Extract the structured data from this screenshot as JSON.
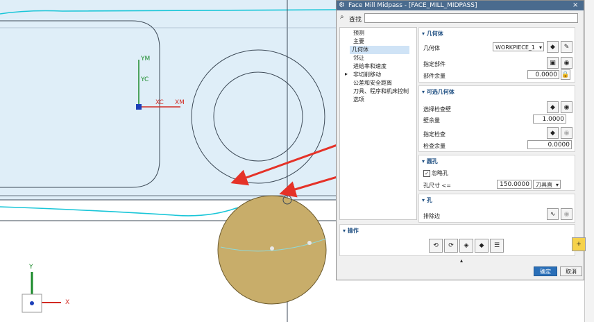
{
  "viewport": {
    "axis_labels": {
      "ym": "YM",
      "yc": "YC",
      "xc": "XC",
      "xm": "XM"
    },
    "triad_labels": {
      "y": "Y",
      "x": "X"
    }
  },
  "dialog": {
    "title": "Face Mill Midpass - [FACE_MILL_MIDPASS]",
    "search_label": "查找",
    "search_value": "",
    "tree": [
      "预测",
      "主要",
      "几何体",
      "邻让",
      "进给率和速度",
      "非切削移动",
      "公差和安全距离",
      "刀具、程序和机床控制",
      "选项"
    ],
    "tree_selected_index": 2,
    "geometry": {
      "header": "几何体",
      "geometry_label": "几何体",
      "geometry_value": "WORKPIECE_1",
      "part_label": "指定部件",
      "part_stock_label": "部件余量",
      "part_stock_value": "0.0000"
    },
    "optional": {
      "header": "可选几何体",
      "select_check_label": "选择检查壁",
      "wall_stock_label": "壁余量",
      "wall_stock_value": "1.0000",
      "specify_check_label": "指定检查",
      "check_stock_label": "检查余量",
      "check_stock_value": "0.0000"
    },
    "round_hole": {
      "header": "圆孔",
      "ignore_label": "忽略孔",
      "ignore_checked": true,
      "hole_size_label": "孔尺寸 <=",
      "hole_size_value": "150.0000",
      "hole_size_unit": "刀具直"
    },
    "hole": {
      "header": "孔",
      "exclude_edge_label": "排除边"
    },
    "operations": {
      "header": "操作"
    },
    "ok_label": "确定",
    "cancel_label": "取消"
  },
  "colors": {
    "title_bar": "#4a6b8e",
    "section_header": "#1f4f82",
    "ok_button": "#2a6fb8",
    "part_face": "#dfeef8",
    "tool_disk": "#c8ad6a",
    "arrow": "#e53228"
  }
}
